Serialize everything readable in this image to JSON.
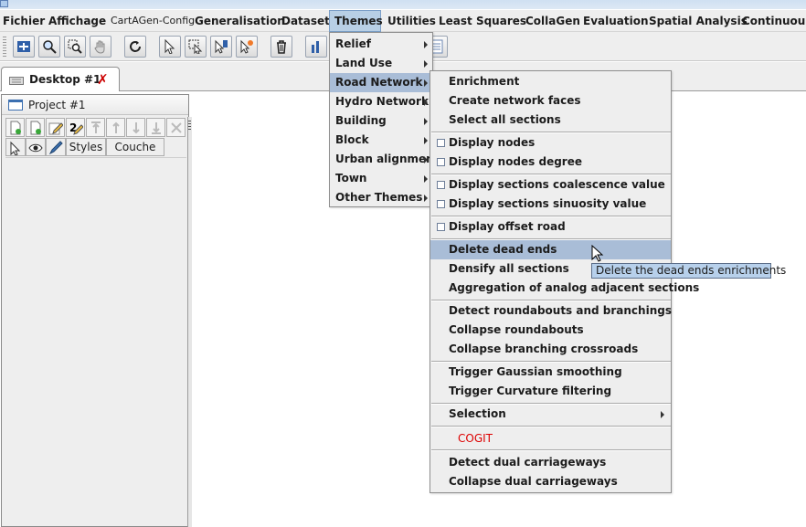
{
  "menubar": {
    "items": [
      "Fichier",
      "Affichage",
      "CartAGen-Config",
      "Generalisation",
      "Dataset",
      "Themes",
      "Utilities",
      "Least Squares",
      "CollaGen",
      "Evaluation",
      "Spatial Analysis",
      "Continuous"
    ],
    "active": "Themes"
  },
  "toolbar": {
    "icons": [
      "extent-icon",
      "zoom-icon",
      "zoom-window-icon",
      "pan-icon",
      "refresh-icon",
      "select-icon",
      "select-box-icon",
      "select-point-icon",
      "deselect-icon",
      "delete-icon",
      "chart-icon",
      "table-icon"
    ]
  },
  "desktop_tab": {
    "label": "Desktop #1"
  },
  "project": {
    "title": "Project #1",
    "columns": [
      "Styles",
      "Couche"
    ],
    "toolbar_icons": [
      "new-layer-icon",
      "new-layer-db-icon",
      "edit-icon",
      "rename-icon",
      "move-top-icon",
      "move-up-icon",
      "move-down-icon",
      "move-bottom-icon",
      "remove-icon"
    ]
  },
  "themes_menu": {
    "items": [
      {
        "label": "Relief",
        "submenu": true
      },
      {
        "label": "Land Use",
        "submenu": true
      },
      {
        "label": "Road Network",
        "submenu": true,
        "highlighted": true
      },
      {
        "label": "Hydro Network",
        "submenu": true
      },
      {
        "label": "Building",
        "submenu": true
      },
      {
        "label": "Block",
        "submenu": true
      },
      {
        "label": "Urban alignment",
        "submenu": true
      },
      {
        "label": "Town",
        "submenu": true
      },
      {
        "label": "Other Themes",
        "submenu": true
      }
    ]
  },
  "road_network_menu": {
    "groups": [
      [
        {
          "label": "Enrichment"
        },
        {
          "label": "Create network faces"
        },
        {
          "label": "Select all sections"
        }
      ],
      [
        {
          "label": "Display nodes",
          "checkbox": true,
          "checked": false
        },
        {
          "label": "Display nodes degree",
          "checkbox": true,
          "checked": false
        }
      ],
      [
        {
          "label": "Display sections coalescence value",
          "checkbox": true,
          "checked": false
        },
        {
          "label": "Display sections sinuosity value",
          "checkbox": true,
          "checked": false
        }
      ],
      [
        {
          "label": "Display offset road",
          "checkbox": true,
          "checked": false
        }
      ],
      [
        {
          "label": "Delete dead ends",
          "highlighted": true
        },
        {
          "label": "Densify all sections"
        },
        {
          "label": "Aggregation of analog adjacent sections"
        }
      ],
      [
        {
          "label": "Detect roundabouts and branchings"
        },
        {
          "label": "Collapse roundabouts"
        },
        {
          "label": "Collapse branching crossroads"
        }
      ],
      [
        {
          "label": "Trigger Gaussian smoothing"
        },
        {
          "label": "Trigger Curvature filtering"
        }
      ],
      [
        {
          "label": "Selection",
          "submenu": true
        }
      ],
      [
        {
          "label": "COGIT",
          "color": "#dd0000"
        }
      ],
      [
        {
          "label": "Detect dual carriageways"
        },
        {
          "label": "Collapse dual carriageways"
        }
      ]
    ]
  },
  "tooltip": {
    "text": "Delete the dead ends enrichments"
  }
}
